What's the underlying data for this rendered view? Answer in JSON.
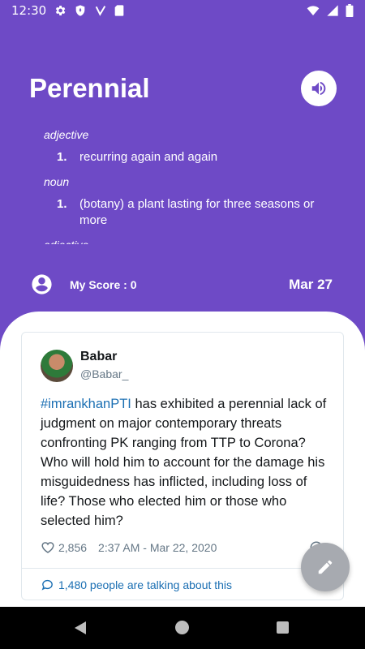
{
  "status_bar": {
    "time": "12:30",
    "icons": [
      "gear-icon",
      "shield-icon",
      "v-icon",
      "sd-card-icon",
      "wifi-icon",
      "signal-icon",
      "battery-icon"
    ]
  },
  "header": {
    "word": "Perennial",
    "definitions": [
      {
        "pos": "adjective",
        "items": [
          {
            "num": "1.",
            "text": "recurring again and again"
          }
        ]
      },
      {
        "pos": "noun",
        "items": [
          {
            "num": "1.",
            "text": "(botany) a plant lasting for three seasons or more"
          }
        ]
      },
      {
        "pos": "adjective",
        "items": []
      }
    ],
    "score_label": "My Score : 0",
    "date": "Mar 27"
  },
  "tweet": {
    "author_name": "Babar",
    "author_handle": "@Babar_",
    "hashtag": "#imrankhanPTI",
    "text": " has exhibited a perennial lack of judgment on major contemporary threats confronting PK ranging from TTP to Corona? Who will hold him to account for the damage his misguidedness has inflicted, including loss of life? Those who elected him or those who selected him?",
    "likes": "2,856",
    "timestamp": "2:37 AM - Mar 22, 2020",
    "talking": "1,480 people are talking about this"
  },
  "colors": {
    "header_bg": "#6e4ac6",
    "link": "#1b6fb3",
    "fab": "#a7aab0"
  }
}
